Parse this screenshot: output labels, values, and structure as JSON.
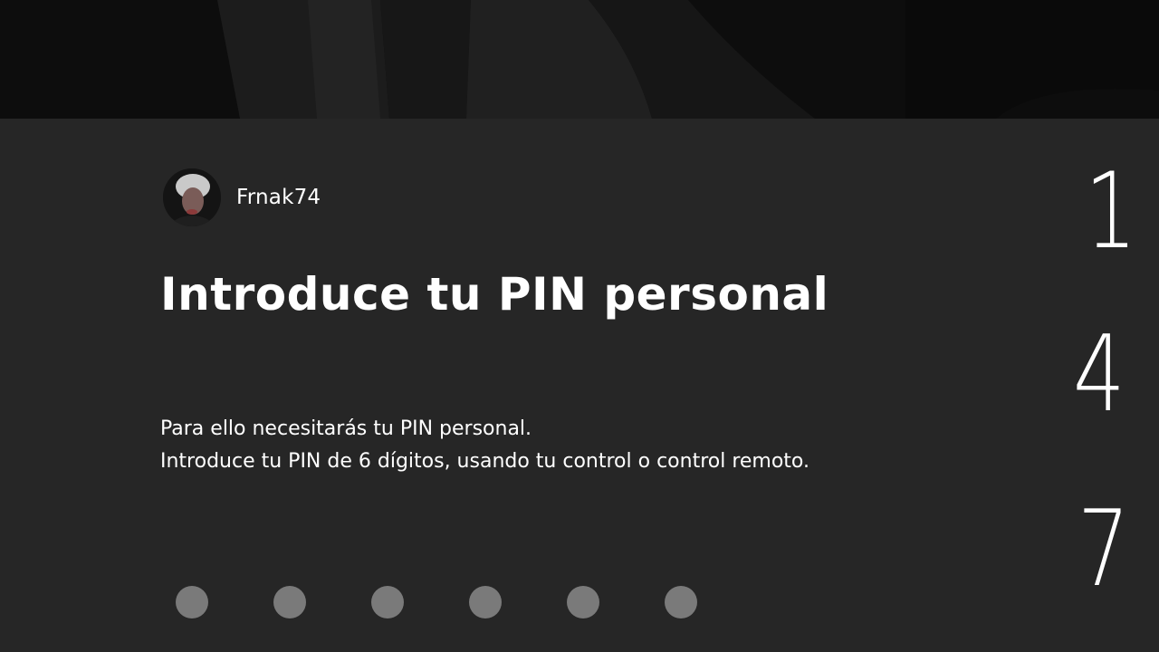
{
  "user": {
    "gamertag": "Frnak74"
  },
  "prompt": {
    "title": "Introduce tu PIN personal",
    "line1": "Para ello necesitarás tu PIN personal.",
    "line2": "Introduce tu PIN de 6 dígitos, usando tu control o control remoto."
  },
  "pin": {
    "length": 6,
    "entered": 0
  },
  "keypad": {
    "keys": [
      "1",
      "4",
      "7"
    ]
  },
  "colors": {
    "panel": "#262626",
    "backdrop": "#0b0b0b",
    "pin_dot": "#7a7a7a",
    "text": "#ffffff"
  }
}
